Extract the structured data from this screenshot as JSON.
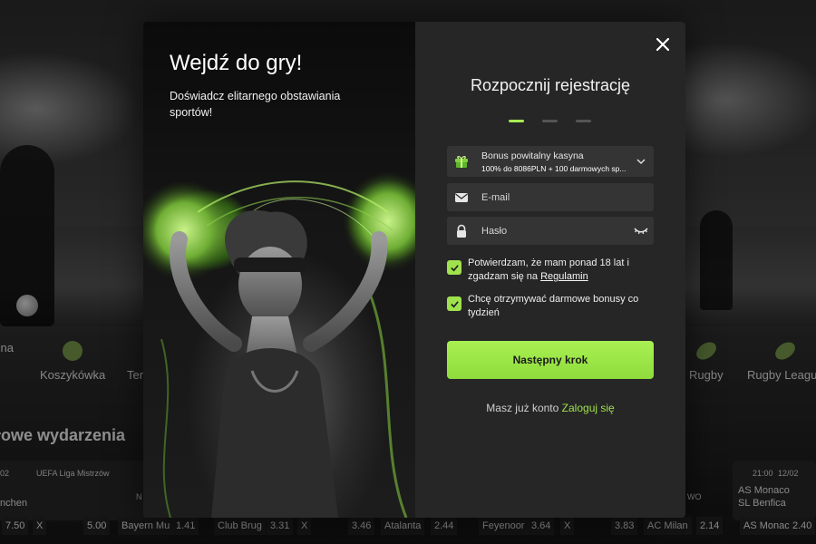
{
  "background": {
    "sport_categories": [
      {
        "label": "żna",
        "icon": "football-icon"
      },
      {
        "label": "Koszykówka",
        "icon": "basketball-icon"
      },
      {
        "label": "Ter",
        "icon": "tennis-icon"
      },
      {
        "label": "Rugby",
        "icon": "rugby-icon"
      },
      {
        "label": "Rugby League",
        "icon": "rugby-icon"
      }
    ],
    "events_title": "łowe wydarzenia",
    "event_left": {
      "date": "02",
      "league": "UEFA Liga Mistrzów",
      "team1": "nchen",
      "badge": "N"
    },
    "event_right": {
      "time": "21:00",
      "date": "12/02",
      "team1": "AS Monaco",
      "team2": "SL Benfica",
      "badge": "WO"
    },
    "odds": [
      "7.50",
      "X",
      "5.00",
      "Bayern Mu",
      "1.41",
      "Club Brug",
      "3.31",
      "X",
      "3.46",
      "Atalanta",
      "2.44",
      "Feyenoor",
      "3.64",
      "X",
      "3.83",
      "AC Milan",
      "2.14",
      "AS Monac",
      "2.40"
    ]
  },
  "promo": {
    "title": "Wejdź do gry!",
    "subtitle": "Doświadcz elitarnego obstawiania sportów!"
  },
  "form": {
    "title": "Rozpocznij rejestrację",
    "steps": [
      true,
      false,
      false
    ],
    "bonus": {
      "line1": "Bonus powitalny kasyna",
      "line2": "100% do 8086PLN + 100 darmowych sp...",
      "icon": "gift-icon"
    },
    "email_placeholder": "E-mail",
    "password_placeholder": "Hasło",
    "age_check": {
      "text": "Potwierdzam, że mam ponad 18 lat i zgadzam się na ",
      "link": "Regulamin",
      "checked": true
    },
    "bonus_check": {
      "text": "Chcę otrzymywać darmowe bonusy co tydzień",
      "checked": true
    },
    "next_button": "Następny krok",
    "login_prompt": "Masz już konto",
    "login_link": "Zaloguj się"
  },
  "colors": {
    "accent": "#9fe24e",
    "form_bg": "#262626",
    "field_bg": "#343434"
  }
}
